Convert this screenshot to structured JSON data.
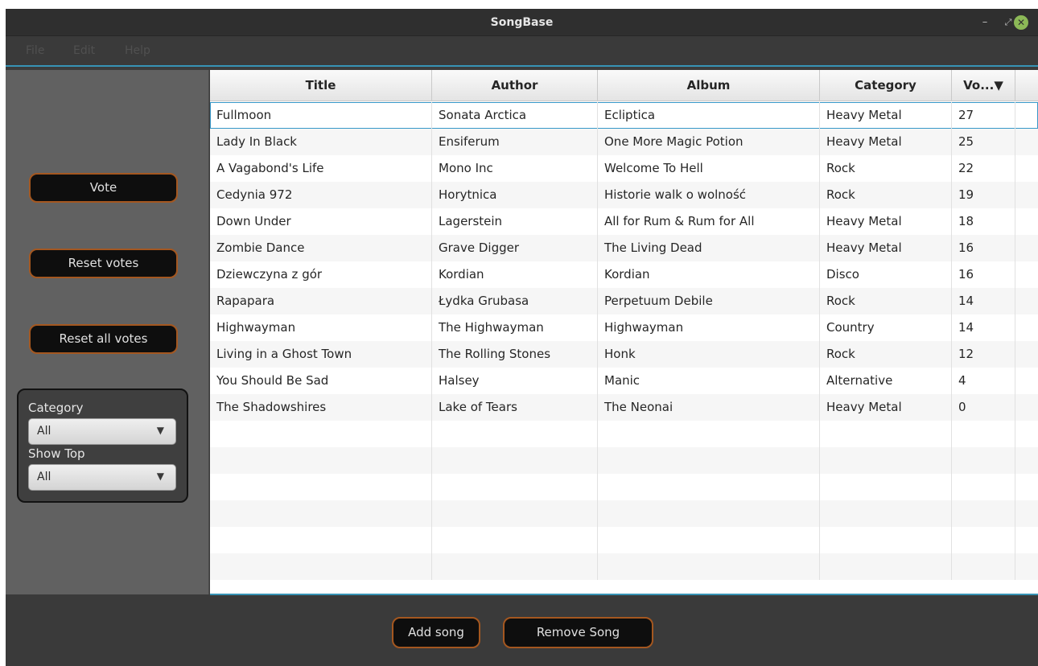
{
  "window": {
    "title": "SongBase",
    "controls": {
      "minimize": "–",
      "maximize": "⤢",
      "close": "✕"
    }
  },
  "menu": [
    "File",
    "Edit",
    "Help"
  ],
  "sidebar": {
    "vote": "Vote",
    "reset_votes": "Reset votes",
    "reset_all_votes": "Reset all votes",
    "category_label": "Category",
    "category_value": "All",
    "show_top_label": "Show Top",
    "show_top_value": "All"
  },
  "table": {
    "columns": [
      "Title",
      "Author",
      "Album",
      "Category",
      "Vo...▼"
    ],
    "rows": [
      [
        "Fullmoon",
        "Sonata Arctica",
        "Ecliptica",
        "Heavy Metal",
        "27"
      ],
      [
        "Lady In Black",
        "Ensiferum",
        "One More Magic Potion",
        "Heavy Metal",
        "25"
      ],
      [
        "A Vagabond's Life",
        "Mono Inc",
        "Welcome To Hell",
        "Rock",
        "22"
      ],
      [
        "Cedynia 972",
        "Horytnica",
        "Historie walk o wolność",
        "Rock",
        "19"
      ],
      [
        "Down Under",
        "Lagerstein",
        "All for Rum & Rum for All",
        "Heavy Metal",
        "18"
      ],
      [
        "Zombie Dance",
        "Grave Digger",
        "The Living Dead",
        "Heavy Metal",
        "16"
      ],
      [
        "Dziewczyna z gór",
        "Kordian",
        "Kordian",
        "Disco",
        "16"
      ],
      [
        "Rapapara",
        "Łydka Grubasa",
        "Perpetuum Debile",
        "Rock",
        "14"
      ],
      [
        "Highwayman",
        "The Highwayman",
        "Highwayman",
        "Country",
        "14"
      ],
      [
        "Living in a Ghost Town",
        "The Rolling Stones",
        "Honk",
        "Rock",
        "12"
      ],
      [
        "You Should Be Sad",
        "Halsey",
        "Manic",
        "Alternative",
        "4"
      ],
      [
        "The Shadowshires",
        "Lake of Tears",
        "The Neonai",
        "Heavy Metal",
        "0"
      ]
    ],
    "selected_row": 0
  },
  "footer": {
    "add_song": "Add song",
    "remove_song": "Remove Song"
  },
  "colors": {
    "button_border": "#a45720",
    "accent": "#3793b5",
    "close_button": "#8cb957"
  }
}
